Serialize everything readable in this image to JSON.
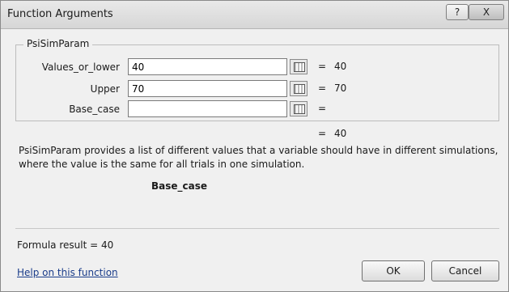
{
  "window": {
    "title": "Function Arguments",
    "help_glyph": "?",
    "close_glyph": "X"
  },
  "function": {
    "name": "PsiSimParam",
    "arguments": [
      {
        "label": "Values_or_lower",
        "value": "40",
        "equals": "=",
        "result": "40"
      },
      {
        "label": "Upper",
        "value": "70",
        "equals": "=",
        "result": "70"
      },
      {
        "label": "Base_case",
        "value": "",
        "equals": "=",
        "result": ""
      }
    ],
    "overall_equals": "=",
    "overall_result": "40",
    "description": "PsiSimParam provides a list of different values that a variable should have in different simulations, where the value is the same for all trials in one simulation.",
    "current_argument": "Base_case"
  },
  "footer": {
    "formula_result": "Formula result =  40",
    "help_link": "Help on this function",
    "ok_label": "OK",
    "cancel_label": "Cancel"
  }
}
